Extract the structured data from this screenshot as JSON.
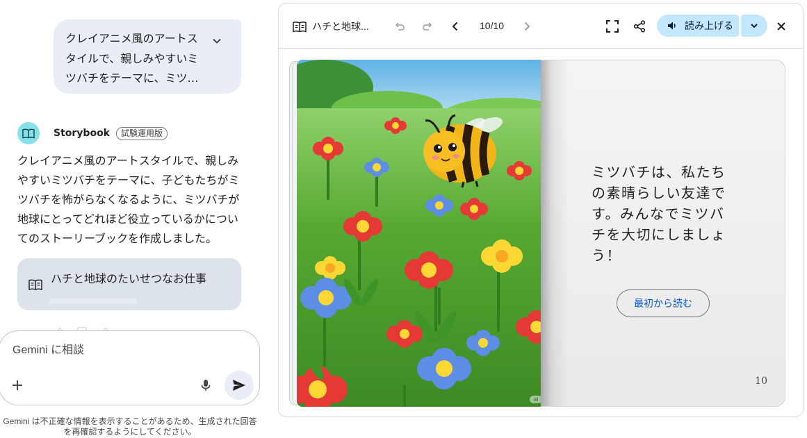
{
  "chat": {
    "user_prompt": "クレイアニメ風のアートスタイルで、親しみやすいミツバチをテーマに、ミツ…",
    "model_name": "Storybook",
    "model_badge": "試験運用版",
    "answer": "クレイアニメ風のアートスタイルで、親しみやすいミツバチをテーマに、子どもたちがミツバチを怖がらなくなるように、ミツバチが地球にとってどれほど役立っているかについてのストーリーブックを作成しました。",
    "book_chip_title": "ハチと地球のたいせつなお仕事",
    "input_placeholder": "Gemini に相談",
    "disclaimer": "Gemini は不正確な情報を表示することがあるため、生成された回答を再確認するようにしてください。"
  },
  "storybook": {
    "title": "ハチと地球...",
    "page_indicator": "10/10",
    "read_aloud_label": "読み上げる",
    "page_text": "ミツバチは、私たちの素晴らしい友達です。みんなでミツバチを大切にしましょう！",
    "restart_label": "最初から読む",
    "page_number": "10",
    "ai_label": "ai"
  },
  "icons": {
    "user_expand": "chevron-down-icon",
    "model_avatar": "book-icon",
    "book_chip": "book-icon",
    "input_add": "plus-icon",
    "input_mic": "mic-icon",
    "input_send": "send-icon",
    "toolbar_book": "book-icon",
    "undo": "undo-icon",
    "redo": "redo-icon",
    "prev": "chevron-left-icon",
    "next": "chevron-right-icon",
    "fullscreen": "fullscreen-icon",
    "share": "share-icon",
    "speaker": "volume-icon",
    "read_options": "chevron-down-icon",
    "close": "close-icon"
  },
  "colors": {
    "user_bubble": "#e9eef6",
    "model_avatar": "#84e1ea",
    "read_button": "#c2e7ff",
    "link_blue": "#0b57d0"
  }
}
